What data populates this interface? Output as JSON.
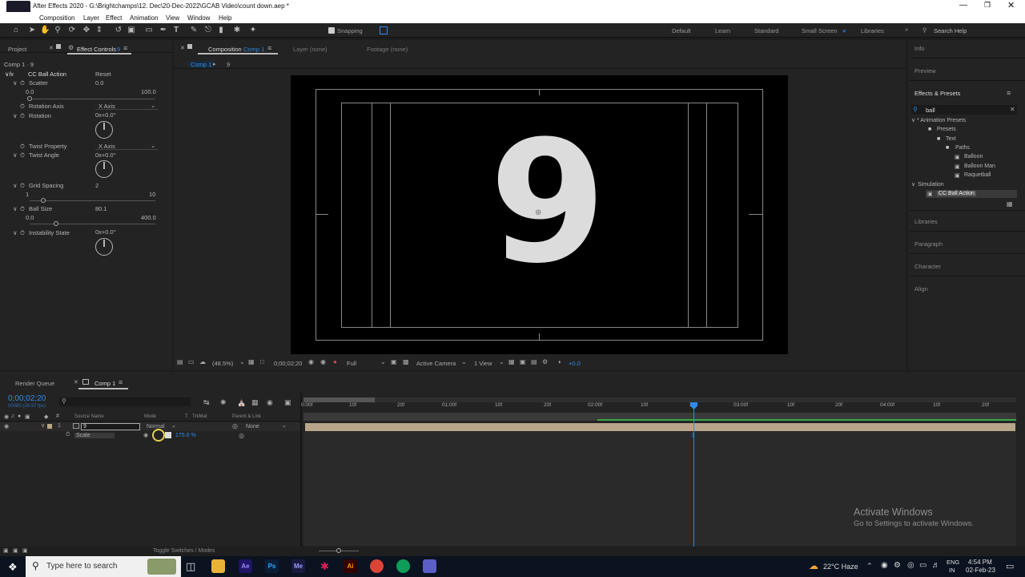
{
  "titlebar": {
    "title": "After Effects 2020 - G:\\Brightchamps\\12. Dec\\20-Dec-2022\\GCAB Video\\count down.aep *"
  },
  "menu": [
    "Composition",
    "Layer",
    "Effect",
    "Animation",
    "View",
    "Window",
    "Help"
  ],
  "toolbar": {
    "snapping": "Snapping"
  },
  "workspaces": {
    "default": "Default",
    "learn": "Learn",
    "standard": "Standard",
    "small_screen": "Small Screen",
    "libraries": "Libraries",
    "search_help": "Search Help"
  },
  "left_panel": {
    "tab_project": "Project",
    "tab_effect_controls": "Effect Controls",
    "tab_effect_controls_layer": "9",
    "breadcrumb": "Comp 1 · 9",
    "effect_name": "CC Ball Action",
    "reset": "Reset",
    "params": {
      "scatter": {
        "label": "Scatter",
        "value": "0.0",
        "min": "0.0",
        "max": "100.0"
      },
      "rotation_axis": {
        "label": "Rotation Axis",
        "value": "X Axis"
      },
      "rotation": {
        "label": "Rotation",
        "value": "0x+0.0°"
      },
      "twist_property": {
        "label": "Twist Property",
        "value": "X Axis"
      },
      "twist_angle": {
        "label": "Twist Angle",
        "value": "0x+0.0°"
      },
      "grid_spacing": {
        "label": "Grid Spacing",
        "value": "2",
        "min": "1",
        "max": "10"
      },
      "ball_size": {
        "label": "Ball Size",
        "value": "80.1",
        "min": "0.0",
        "max": "400.0"
      },
      "instability_state": {
        "label": "Instability State",
        "value": "0x+0.0°"
      }
    }
  },
  "center": {
    "tab_composition": "Composition",
    "tab_composition_name": "Comp 1",
    "layer_tab": "Layer (none)",
    "footage_tab": "Footage (none)",
    "crumb_comp": "Comp 1",
    "crumb_layer": "9",
    "canvas_text": "9",
    "viewer_bar": {
      "zoom": "(48.5%)",
      "timecode": "0;00;02;20",
      "resolution": "Full",
      "camera": "Active Camera",
      "view": "1 View",
      "exposure": "+0.0"
    }
  },
  "right_panel": {
    "info": "Info",
    "preview": "Preview",
    "effects_presets": "Effects & Presets",
    "search": "ball",
    "tree": [
      "* Animation Presets",
      "Presets",
      "Text",
      "Paths",
      "Balloon",
      "Balloon Man",
      "Raquetball",
      "Simulation",
      "CC Ball Action"
    ],
    "libraries": "Libraries",
    "paragraph": "Paragraph",
    "character": "Character",
    "align": "Align"
  },
  "timeline": {
    "tab_render_queue": "Render Queue",
    "tab_comp": "Comp 1",
    "timecode": "0;00;02;20",
    "frames_info": "00080 (29.97 fps)",
    "columns": {
      "source_name": "Source Name",
      "mode": "Mode",
      "t": "T",
      "trkmat": "TrkMat",
      "parent": "Parent & Link"
    },
    "layer": {
      "index": "1",
      "name": "9",
      "mode": "Normal",
      "parent": "None"
    },
    "property": {
      "name": "Scale",
      "value": "175.0 %"
    },
    "ruler": [
      "0:00f",
      "10f",
      "20f",
      "01:00f",
      "10f",
      "20f",
      "02:00f",
      "10f",
      "20f",
      "03:00f",
      "10f",
      "20f",
      "04:00f",
      "10f",
      "20f"
    ],
    "footer": "Toggle Switches / Modes"
  },
  "watermark": {
    "line1": "Activate Windows",
    "line2": "Go to Settings to activate Windows."
  },
  "taskbar": {
    "search_placeholder": "Type here to search",
    "weather": "22°C  Haze",
    "lang1": "ENG",
    "lang2": "IN",
    "time": "4:54 PM",
    "date": "02-Feb-23"
  },
  "colors": {
    "accent_blue": "#2d8ceb",
    "panel_bg": "#232323",
    "layer_bar": "#b7a68a",
    "green_workarea": "#3aa845"
  }
}
